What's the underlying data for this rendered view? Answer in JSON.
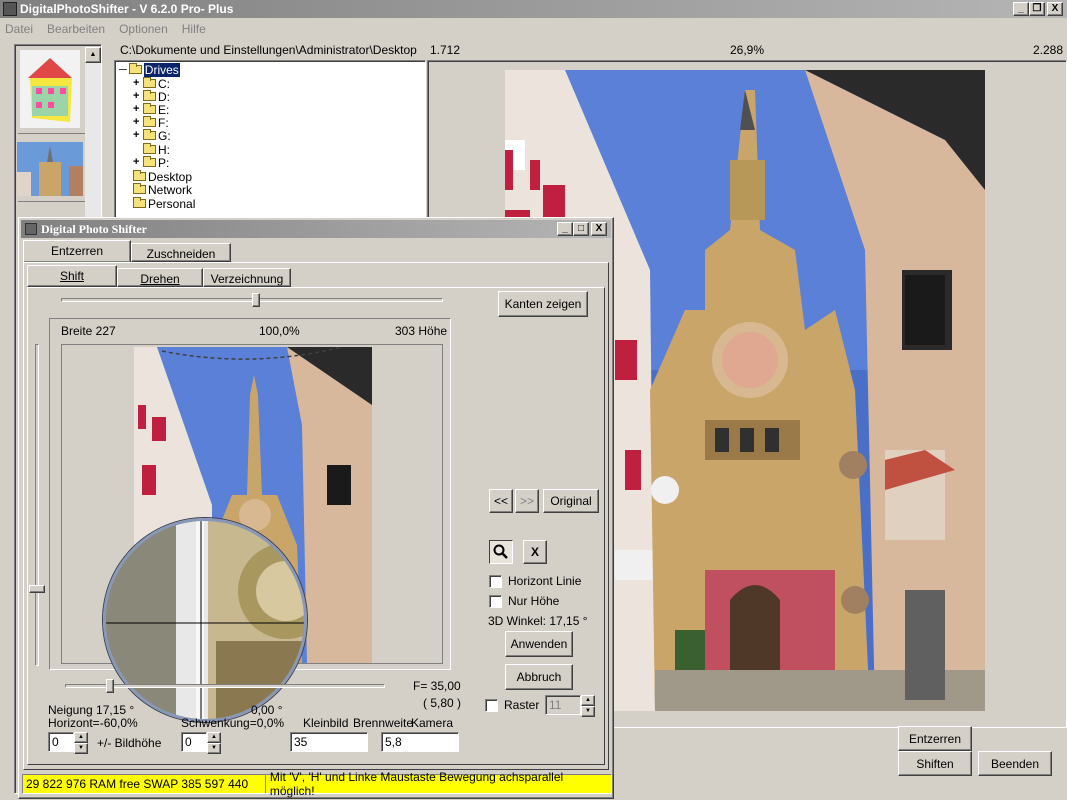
{
  "window": {
    "title": "DigitalPhotoShifter - V 6.2.0 Pro- Plus",
    "min": "_",
    "max": "❐",
    "close": "X"
  },
  "menu": [
    "Datei",
    "Bearbeiten",
    "Optionen",
    "Hilfe"
  ],
  "header": {
    "path": "C:\\Dokumente und Einstellungen\\Administrator\\Desktop",
    "width_value": "1.712",
    "zoom": "26,9%",
    "height_value": "2.288"
  },
  "tree": {
    "root": "Drives",
    "drives": [
      "C:",
      "D:",
      "E:",
      "F:",
      "G:",
      "H:",
      "P:"
    ],
    "folders": [
      "Desktop",
      "Network",
      "Personal"
    ]
  },
  "dialog": {
    "title": "Digital Photo Shifter",
    "tabs_top": [
      "Entzerren",
      "Zuschneiden"
    ],
    "tabs_sub": [
      "Shift",
      "Drehen",
      "Verzeichnung"
    ],
    "btn_kanten": "Kanten zeigen",
    "preview_width": "Breite 227",
    "preview_zoom": "100,0%",
    "preview_height": "303 Höhe",
    "btn_prev": "<<",
    "btn_next": ">>",
    "btn_original": "Original",
    "btn_zoom_icon": "magnifier-icon",
    "btn_x": "X",
    "chk_horizont": "Horizont Linie",
    "chk_nurhoehe": "Nur Höhe",
    "winkel": "3D Winkel: 17,15 °",
    "btn_anwenden": "Anwenden",
    "btn_abbruch": "Abbruch",
    "chk_raster": "Raster",
    "raster_value": "11",
    "f_value": "F= 35,00",
    "f_sub": "( 5,80 )",
    "neigung": "Neigung 17,15 °",
    "horizont": "Horizont=-60,0%",
    "schwenkung_deg": "0,00 °",
    "schwenkung": "Schwenkung=0,0%",
    "kleinbild": "Kleinbild",
    "brennweite": "Brennweite",
    "kamera": "Kamera",
    "spin1": "0",
    "bildhoehe": "+/- Bildhöhe",
    "spin2": "0",
    "field_kleinbild": "35",
    "field_kamera": "5,8"
  },
  "status": {
    "memory": "29 822 976 RAM free SWAP  385 597 440",
    "hint": "Mit 'V', 'H' und Linke Maustaste Bewegung achsparallel möglich!"
  },
  "buttons": {
    "entzerren": "Entzerren",
    "shiften": "Shiften",
    "beenden": "Beenden"
  },
  "colors": {
    "status_yellow": "#ffff00",
    "tree_selection": "#0a246a"
  },
  "sliders": {
    "preview_h": 0.51,
    "preview_v": 0.76,
    "neigung": 0.14
  }
}
